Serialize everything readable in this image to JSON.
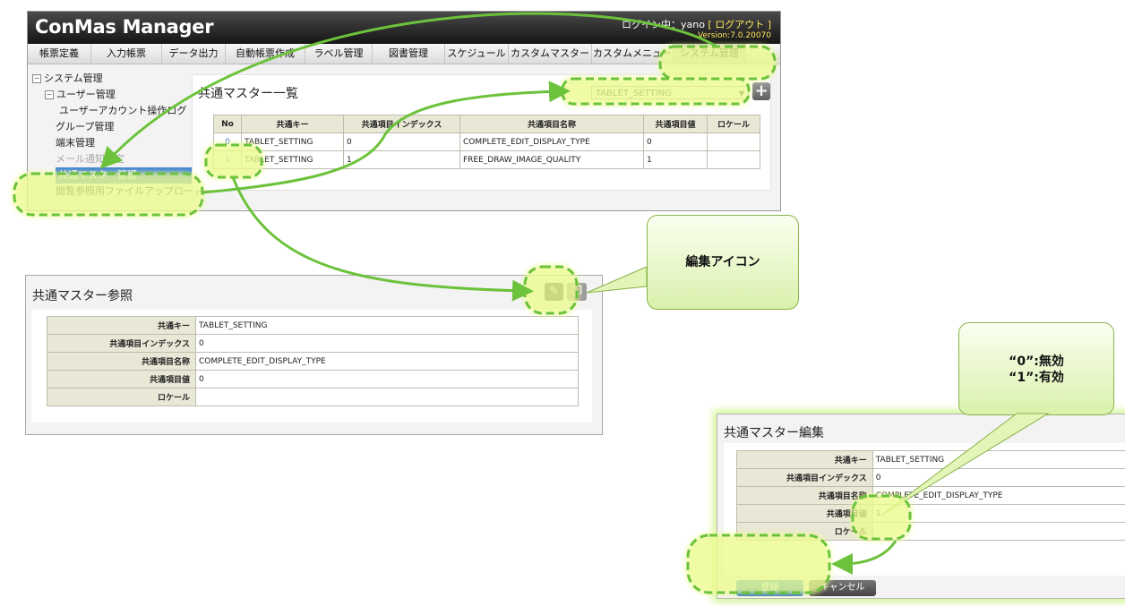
{
  "app": {
    "title": "ConMas Manager",
    "login_prefix": "ログイン中：",
    "login_user": "yano",
    "logout": "[ ログアウト ]",
    "version": "Version:7.0.20070"
  },
  "menu": [
    "帳票定義",
    "入力帳票",
    "データ出力",
    "自動帳票作成",
    "ラベル管理",
    "図書管理",
    "スケジュール",
    "カスタムマスター",
    "カスタムメニュー",
    "システム管理"
  ],
  "menu_active": "システム管理",
  "tree": {
    "root": "システム管理",
    "user_mgmt": "ユーザー管理",
    "user_log": "ユーザーアカウント操作ログ",
    "group": "グループ管理",
    "device": "端末管理",
    "mail": "メール通知設定",
    "common_master": "共通マスター管理",
    "upload": "閲覧参照用ファイルアップロード"
  },
  "list_panel": {
    "title": "共通マスター一覧",
    "selected_key": "TABLET_SETTING",
    "columns": [
      "No",
      "共通キー",
      "共通項目インデックス",
      "共通項目名称",
      "共通項目値",
      "ロケール"
    ],
    "rows": [
      [
        "0",
        "TABLET_SETTING",
        "0",
        "COMPLETE_EDIT_DISPLAY_TYPE",
        "0",
        ""
      ],
      [
        "1",
        "TABLET_SETTING",
        "1",
        "FREE_DRAW_IMAGE_QUALITY",
        "1",
        ""
      ]
    ]
  },
  "ref_panel": {
    "title": "共通マスター参照",
    "fields": [
      {
        "label": "共通キー",
        "value": "TABLET_SETTING"
      },
      {
        "label": "共通項目インデックス",
        "value": "0"
      },
      {
        "label": "共通項目名称",
        "value": "COMPLETE_EDIT_DISPLAY_TYPE"
      },
      {
        "label": "共通項目値",
        "value": "0"
      },
      {
        "label": "ロケール",
        "value": ""
      }
    ]
  },
  "edit_panel": {
    "title": "共通マスター編集",
    "fields": [
      {
        "label": "共通キー",
        "value": "TABLET_SETTING"
      },
      {
        "label": "共通項目インデックス",
        "value": "0"
      },
      {
        "label": "共通項目名称",
        "value": "COMPLETE_EDIT_DISPLAY_TYPE"
      },
      {
        "label": "共通項目値",
        "value": "1"
      },
      {
        "label": "ロケール",
        "value": ""
      }
    ],
    "save": "登録",
    "cancel": "キャンセル"
  },
  "callouts": {
    "edit_icon": "編集アイコン",
    "values_line1": "“0”:無効",
    "values_line2": "“1”:有効"
  },
  "colors": {
    "highlight": "#6cc23b",
    "glow": "#ecfc8e",
    "selected": "#3d82d4"
  }
}
